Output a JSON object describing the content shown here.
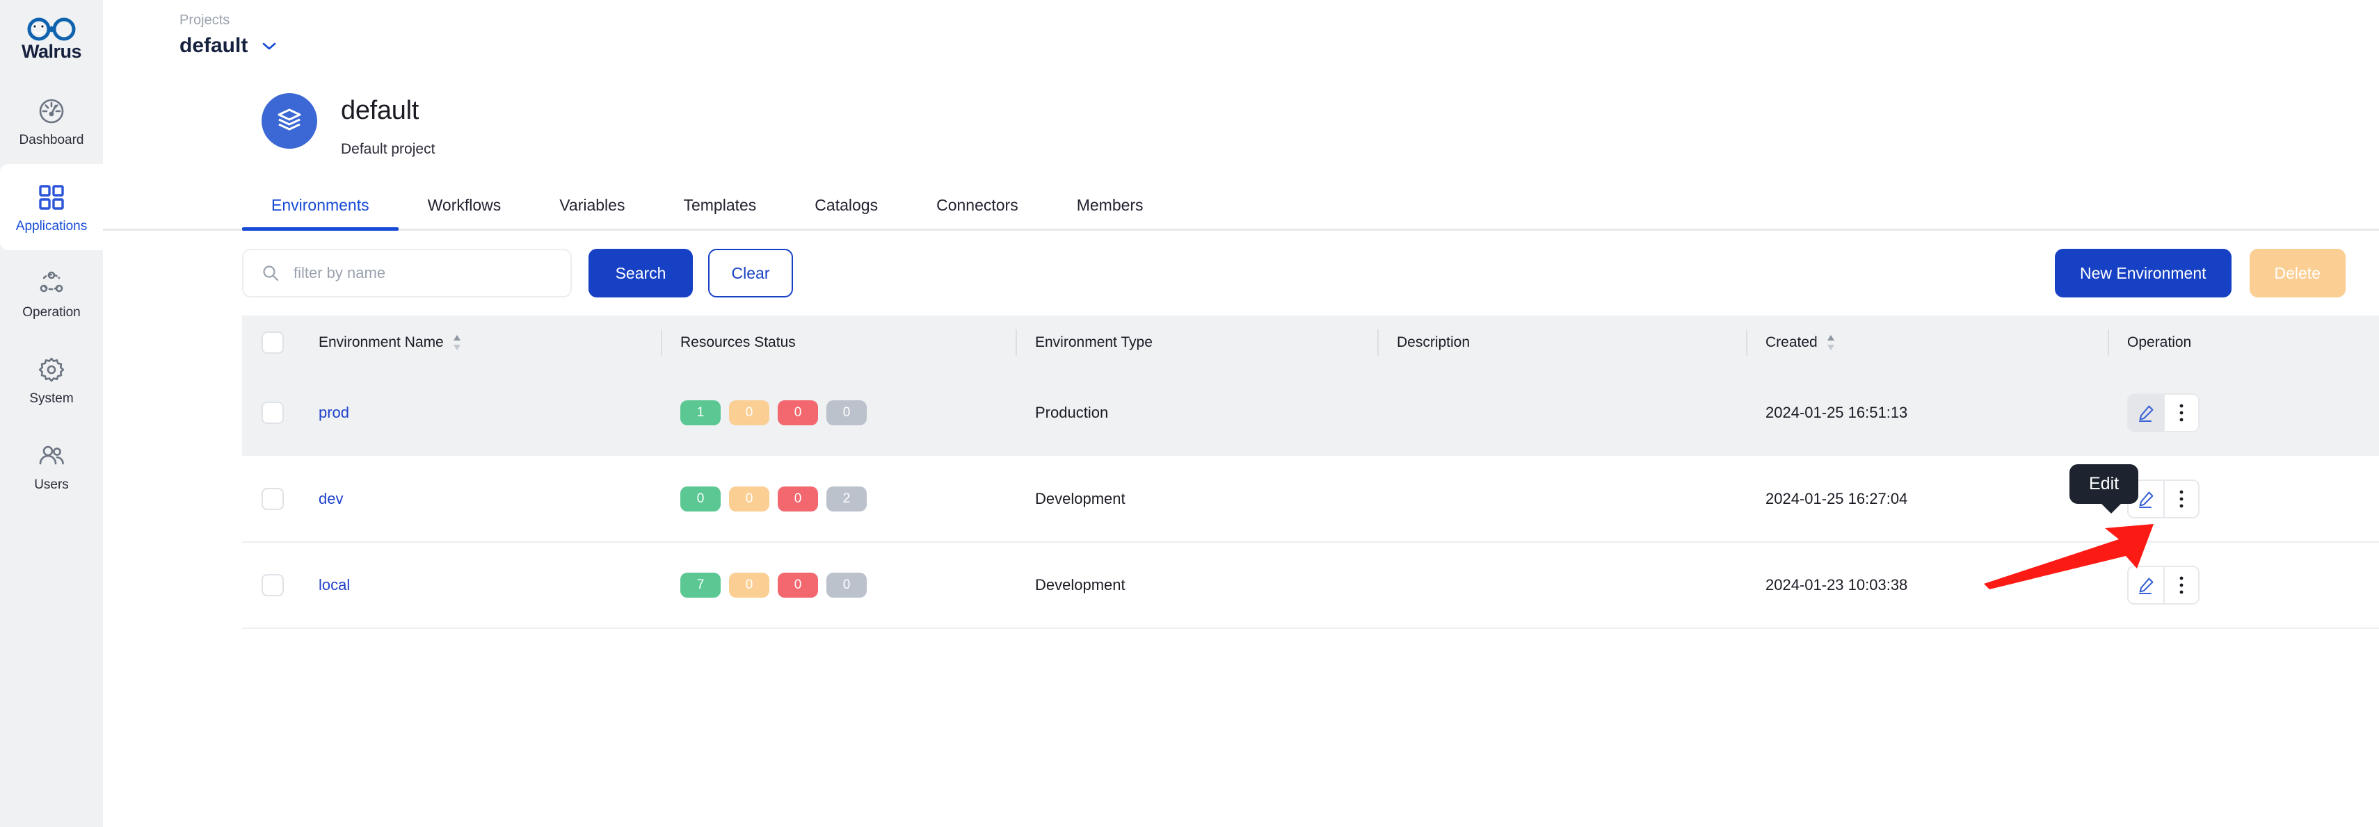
{
  "brand": {
    "name": "Walrus",
    "logo_icon": "walrus-infinity-logo"
  },
  "sidebar": {
    "items": [
      {
        "label": "Dashboard",
        "icon": "gauge-icon",
        "active": false
      },
      {
        "label": "Applications",
        "icon": "grid-squares-icon",
        "active": true
      },
      {
        "label": "Operation",
        "icon": "nodes-icon",
        "active": false
      },
      {
        "label": "System",
        "icon": "gear-icon",
        "active": false
      },
      {
        "label": "Users",
        "icon": "users-icon",
        "active": false
      }
    ]
  },
  "breadcrumb": {
    "parent": "Projects",
    "current": "default",
    "chevron_icon": "chevron-down-icon"
  },
  "project": {
    "avatar_icon": "layers-stack-icon",
    "title": "default",
    "description": "Default project"
  },
  "tabs": [
    {
      "label": "Environments",
      "active": true
    },
    {
      "label": "Workflows",
      "active": false
    },
    {
      "label": "Variables",
      "active": false
    },
    {
      "label": "Templates",
      "active": false
    },
    {
      "label": "Catalogs",
      "active": false
    },
    {
      "label": "Connectors",
      "active": false
    },
    {
      "label": "Members",
      "active": false
    }
  ],
  "toolbar": {
    "search_placeholder": "filter by name",
    "search_value": "",
    "search_icon": "search-icon",
    "search_label": "Search",
    "clear_label": "Clear",
    "new_environment_label": "New Environment",
    "delete_label": "Delete"
  },
  "table": {
    "columns": [
      {
        "key": "select",
        "label": "",
        "sortable": false
      },
      {
        "key": "name",
        "label": "Environment Name",
        "sortable": true
      },
      {
        "key": "resources",
        "label": "Resources Status",
        "sortable": false
      },
      {
        "key": "type",
        "label": "Environment Type",
        "sortable": false
      },
      {
        "key": "description",
        "label": "Description",
        "sortable": false
      },
      {
        "key": "created",
        "label": "Created",
        "sortable": true
      },
      {
        "key": "operation",
        "label": "Operation",
        "sortable": false
      }
    ],
    "rows": [
      {
        "selected": false,
        "name": "prod",
        "badges": [
          {
            "value": "1",
            "color": "#5bc894"
          },
          {
            "value": "0",
            "color": "#fbcf93"
          },
          {
            "value": "0",
            "color": "#f2686e"
          },
          {
            "value": "0",
            "color": "#bcc2cc"
          }
        ],
        "type": "Production",
        "description": "",
        "created": "2024-01-25 16:51:13",
        "highlighted": true
      },
      {
        "selected": false,
        "name": "dev",
        "badges": [
          {
            "value": "0",
            "color": "#5bc894"
          },
          {
            "value": "0",
            "color": "#fbcf93"
          },
          {
            "value": "0",
            "color": "#f2686e"
          },
          {
            "value": "2",
            "color": "#bcc2cc"
          }
        ],
        "type": "Development",
        "description": "",
        "created": "2024-01-25 16:27:04",
        "highlighted": false
      },
      {
        "selected": false,
        "name": "local",
        "badges": [
          {
            "value": "7",
            "color": "#5bc894"
          },
          {
            "value": "0",
            "color": "#fbcf93"
          },
          {
            "value": "0",
            "color": "#f2686e"
          },
          {
            "value": "0",
            "color": "#bcc2cc"
          }
        ],
        "type": "Development",
        "description": "",
        "created": "2024-01-23 10:03:38",
        "highlighted": false
      }
    ],
    "row_actions": {
      "edit_icon": "pencil-icon",
      "more_icon": "vertical-dots-icon"
    }
  },
  "tooltip": {
    "text": "Edit"
  },
  "annotation": {
    "type": "arrow",
    "color": "#fc1b14",
    "points_to": "edit-button-row-prod"
  },
  "colors": {
    "accent_blue": "#1741c4",
    "link_blue": "#1f41c9",
    "sidebar_bg": "#eff1f3",
    "row_highlight": "#eff1f3",
    "tooltip_bg": "#1d2430",
    "delete_btn": "#fbcf93"
  }
}
